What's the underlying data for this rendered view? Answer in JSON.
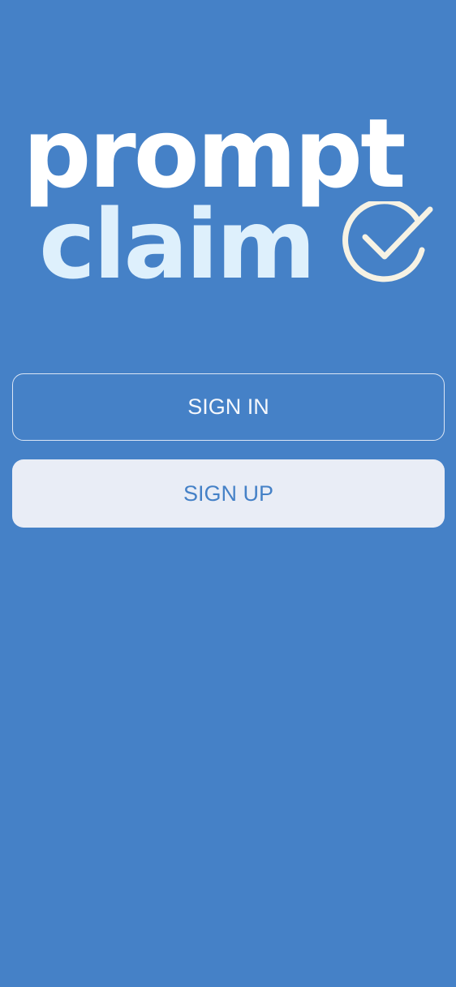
{
  "logo": {
    "line1": "prompt",
    "line2": "claim",
    "icon": "check-circle-icon"
  },
  "buttons": {
    "sign_in": "SIGN IN",
    "sign_up": "SIGN UP"
  },
  "colors": {
    "background": "#4581c7",
    "logo_primary": "#ffffff",
    "logo_secondary": "#def0fc",
    "signup_bg": "#e9edf6"
  }
}
